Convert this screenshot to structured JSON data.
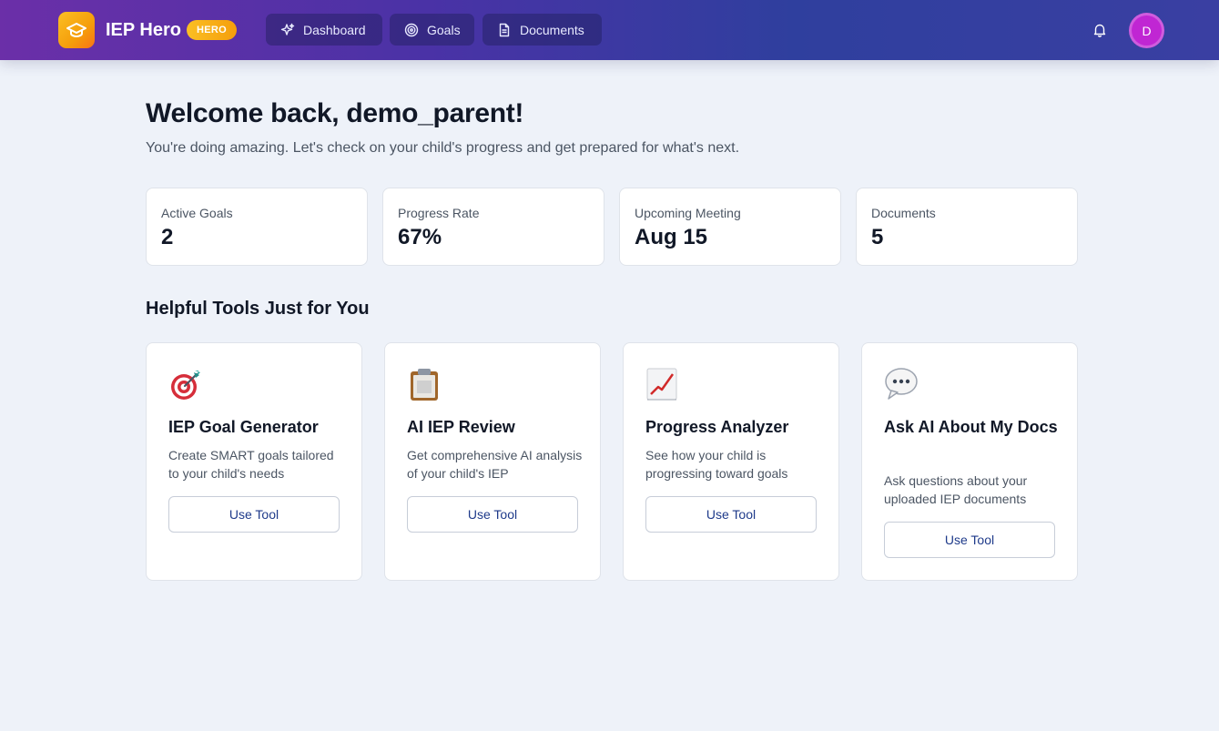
{
  "header": {
    "brand": "IEP Hero",
    "badge": "HERO",
    "nav": [
      {
        "label": "Dashboard",
        "icon": "sparkles-icon"
      },
      {
        "label": "Goals",
        "icon": "target-icon"
      },
      {
        "label": "Documents",
        "icon": "document-icon"
      }
    ],
    "avatar_initial": "D"
  },
  "main": {
    "welcome": "Welcome back, demo_parent!",
    "subtitle": "You're doing amazing. Let's check on your child's progress and get prepared for what's next.",
    "stats": [
      {
        "label": "Active Goals",
        "value": "2"
      },
      {
        "label": "Progress Rate",
        "value": "67%"
      },
      {
        "label": "Upcoming Meeting",
        "value": "Aug 15"
      },
      {
        "label": "Documents",
        "value": "5"
      }
    ],
    "tools_title": "Helpful Tools Just for You",
    "tools": [
      {
        "title": "IEP Goal Generator",
        "desc": "Create SMART goals tailored to your child's needs",
        "button": "Use Tool",
        "icon": "dart-target-icon"
      },
      {
        "title": "AI IEP Review",
        "desc": "Get comprehensive AI analysis of your child's IEP",
        "button": "Use Tool",
        "icon": "clipboard-icon"
      },
      {
        "title": "Progress Analyzer",
        "desc": "See how your child is progressing toward goals",
        "button": "Use Tool",
        "icon": "chart-increasing-icon"
      },
      {
        "title": "Ask AI About My Docs",
        "desc": "Ask questions about your uploaded IEP documents",
        "button": "Use Tool",
        "icon": "speech-bubble-icon"
      }
    ]
  },
  "colors": {
    "header_gradient_start": "#6b2fa8",
    "header_gradient_end": "#3a3fa2",
    "brand_accent": "#f59e0b",
    "avatar": "#c026d3",
    "button_text": "#1e3a8a"
  }
}
